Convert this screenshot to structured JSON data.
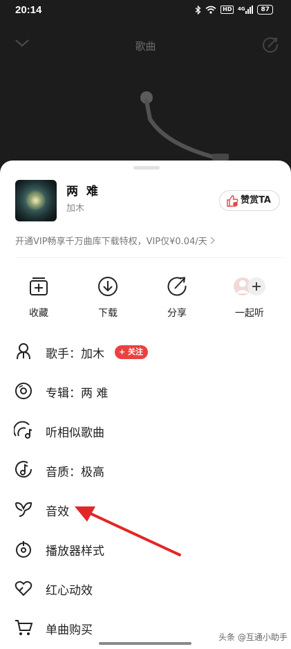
{
  "status_bar": {
    "time": "20:14",
    "hd": "HD",
    "signal": "4G",
    "battery": "87"
  },
  "player": {
    "header_title": "歌曲"
  },
  "song": {
    "title": "两 难",
    "artist": "加木",
    "reward_label": "赞赏TA"
  },
  "vip": {
    "text": "开通VIP畅享千万曲库下载特权，VIP仅¥0.04/天"
  },
  "actions": [
    {
      "label": "收藏",
      "icon": "collect-icon"
    },
    {
      "label": "下载",
      "icon": "download-icon"
    },
    {
      "label": "分享",
      "icon": "share-icon"
    },
    {
      "label": "一起听",
      "icon": "listen-together-icon"
    }
  ],
  "menu": [
    {
      "label": "歌手：加木",
      "icon": "singer-icon",
      "badge": "关注"
    },
    {
      "label": "专辑：两 难",
      "icon": "album-icon"
    },
    {
      "label": "听相似歌曲",
      "icon": "similar-songs-icon"
    },
    {
      "label": "音质：极高",
      "icon": "quality-icon"
    },
    {
      "label": "音效",
      "icon": "sound-effect-icon"
    },
    {
      "label": "播放器样式",
      "icon": "player-style-icon"
    },
    {
      "label": "红心动效",
      "icon": "heart-effect-icon"
    },
    {
      "label": "单曲购买",
      "icon": "cart-icon"
    }
  ],
  "watermark": "头条 @互通小助手",
  "colors": {
    "accent_red": "#ec4141",
    "annotation_arrow": "#e32626"
  }
}
